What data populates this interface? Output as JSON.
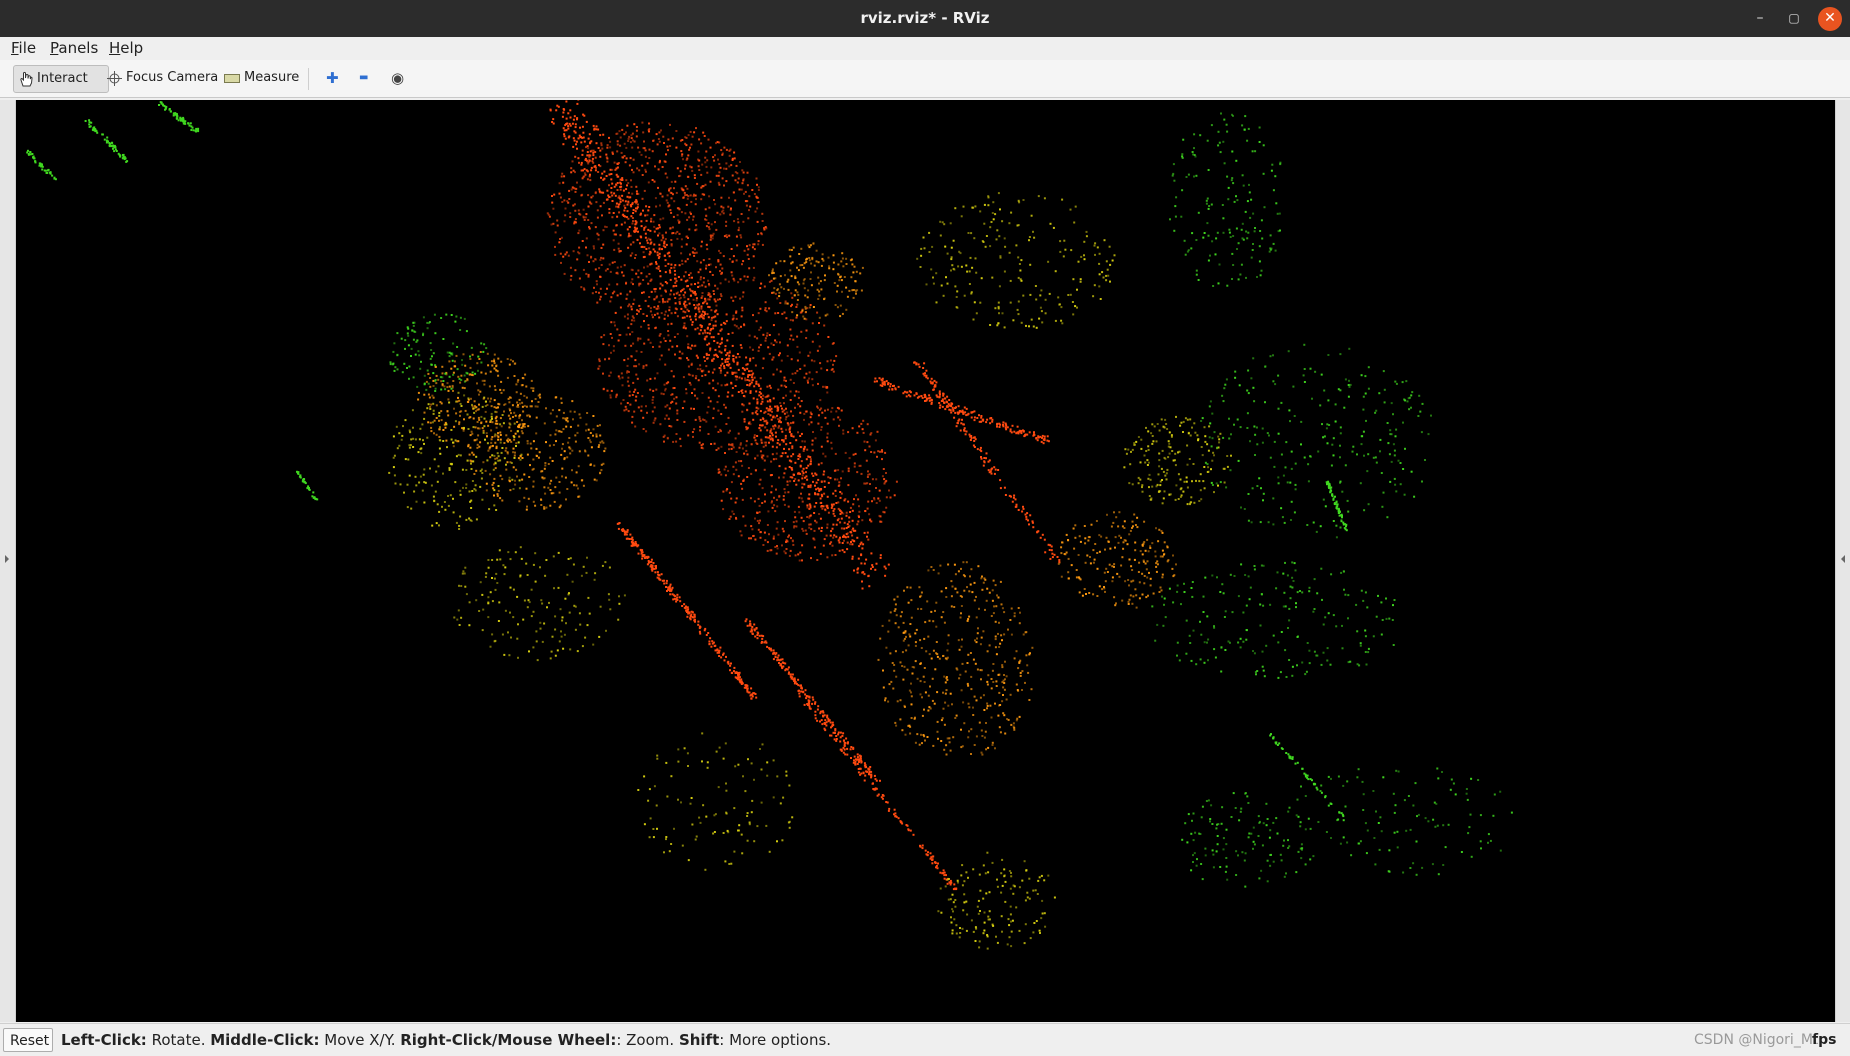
{
  "window": {
    "title": "rviz.rviz* - RViz",
    "minimize_glyph": "–",
    "maximize_glyph": "▢",
    "close_glyph": "✕"
  },
  "menu": {
    "file_accel": "F",
    "file_rest": "ile",
    "panels_accel": "P",
    "panels_rest": "anels",
    "help_accel": "H",
    "help_rest": "elp"
  },
  "toolbar": {
    "interact_label": "Interact",
    "focus_label": "Focus Camera",
    "measure_label": "Measure",
    "plus_glyph": "✚",
    "minus_glyph": "▬",
    "eye_glyph": "◉",
    "icons": [
      "hand-icon",
      "focus-crosshair-icon",
      "ruler-icon",
      "add-pose-icon",
      "remove-icon",
      "camera-view-icon"
    ]
  },
  "status": {
    "reset_label": "Reset",
    "left_key": "Left-Click:",
    "left_desc": " Rotate. ",
    "middle_key": "Middle-Click:",
    "middle_desc": " Move X/Y. ",
    "right_key": "Right-Click/Mouse Wheel:",
    "right_desc": ": Zoom. ",
    "shift_key": "Shift",
    "shift_desc": ": More options.",
    "fps": "fps",
    "watermark": "CSDN @Nigori_Mt"
  },
  "colors": {
    "titlebar": "#2c2c2c",
    "close_button": "#e95420",
    "viewport_bg": "#000000",
    "point_hot": "#ff4a10",
    "point_warm": "#ff9a10",
    "point_mid": "#d8d010",
    "point_cool": "#40d820"
  }
}
